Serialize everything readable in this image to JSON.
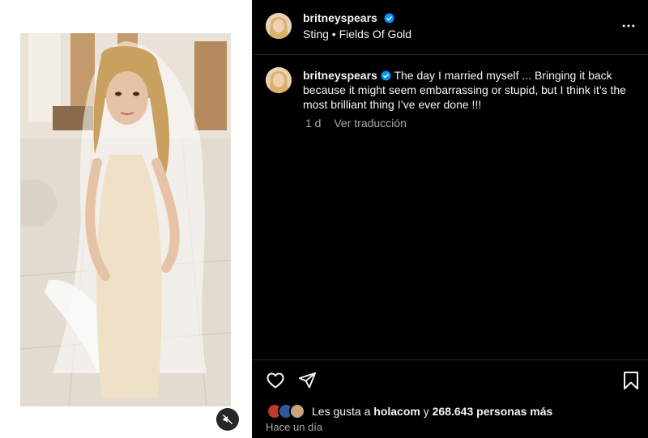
{
  "post": {
    "username": "britneyspears",
    "audio": "Sting • Fields Of Gold",
    "caption_text": "The day I married myself ... Bringing it back because it might seem embarrassing or stupid, but I think it’s the most brilliant thing I’ve ever done !!!",
    "age": "1 d",
    "translate_label": "Ver traducción",
    "likes_prefix": "Les gusta a",
    "likes_user": "holacom",
    "likes_connector": "y",
    "likes_count": "268.643 personas más",
    "timestamp": "Hace un día"
  },
  "icons": {
    "verified": "verified-badge-icon",
    "more": "more-options-icon",
    "like": "heart-icon",
    "share": "send-icon",
    "save": "bookmark-icon",
    "mute": "speaker-muted-icon"
  },
  "colors": {
    "background": "#000000",
    "verified": "#0095f6",
    "secondary_text": "#a8a8a8",
    "divider": "#262626"
  }
}
